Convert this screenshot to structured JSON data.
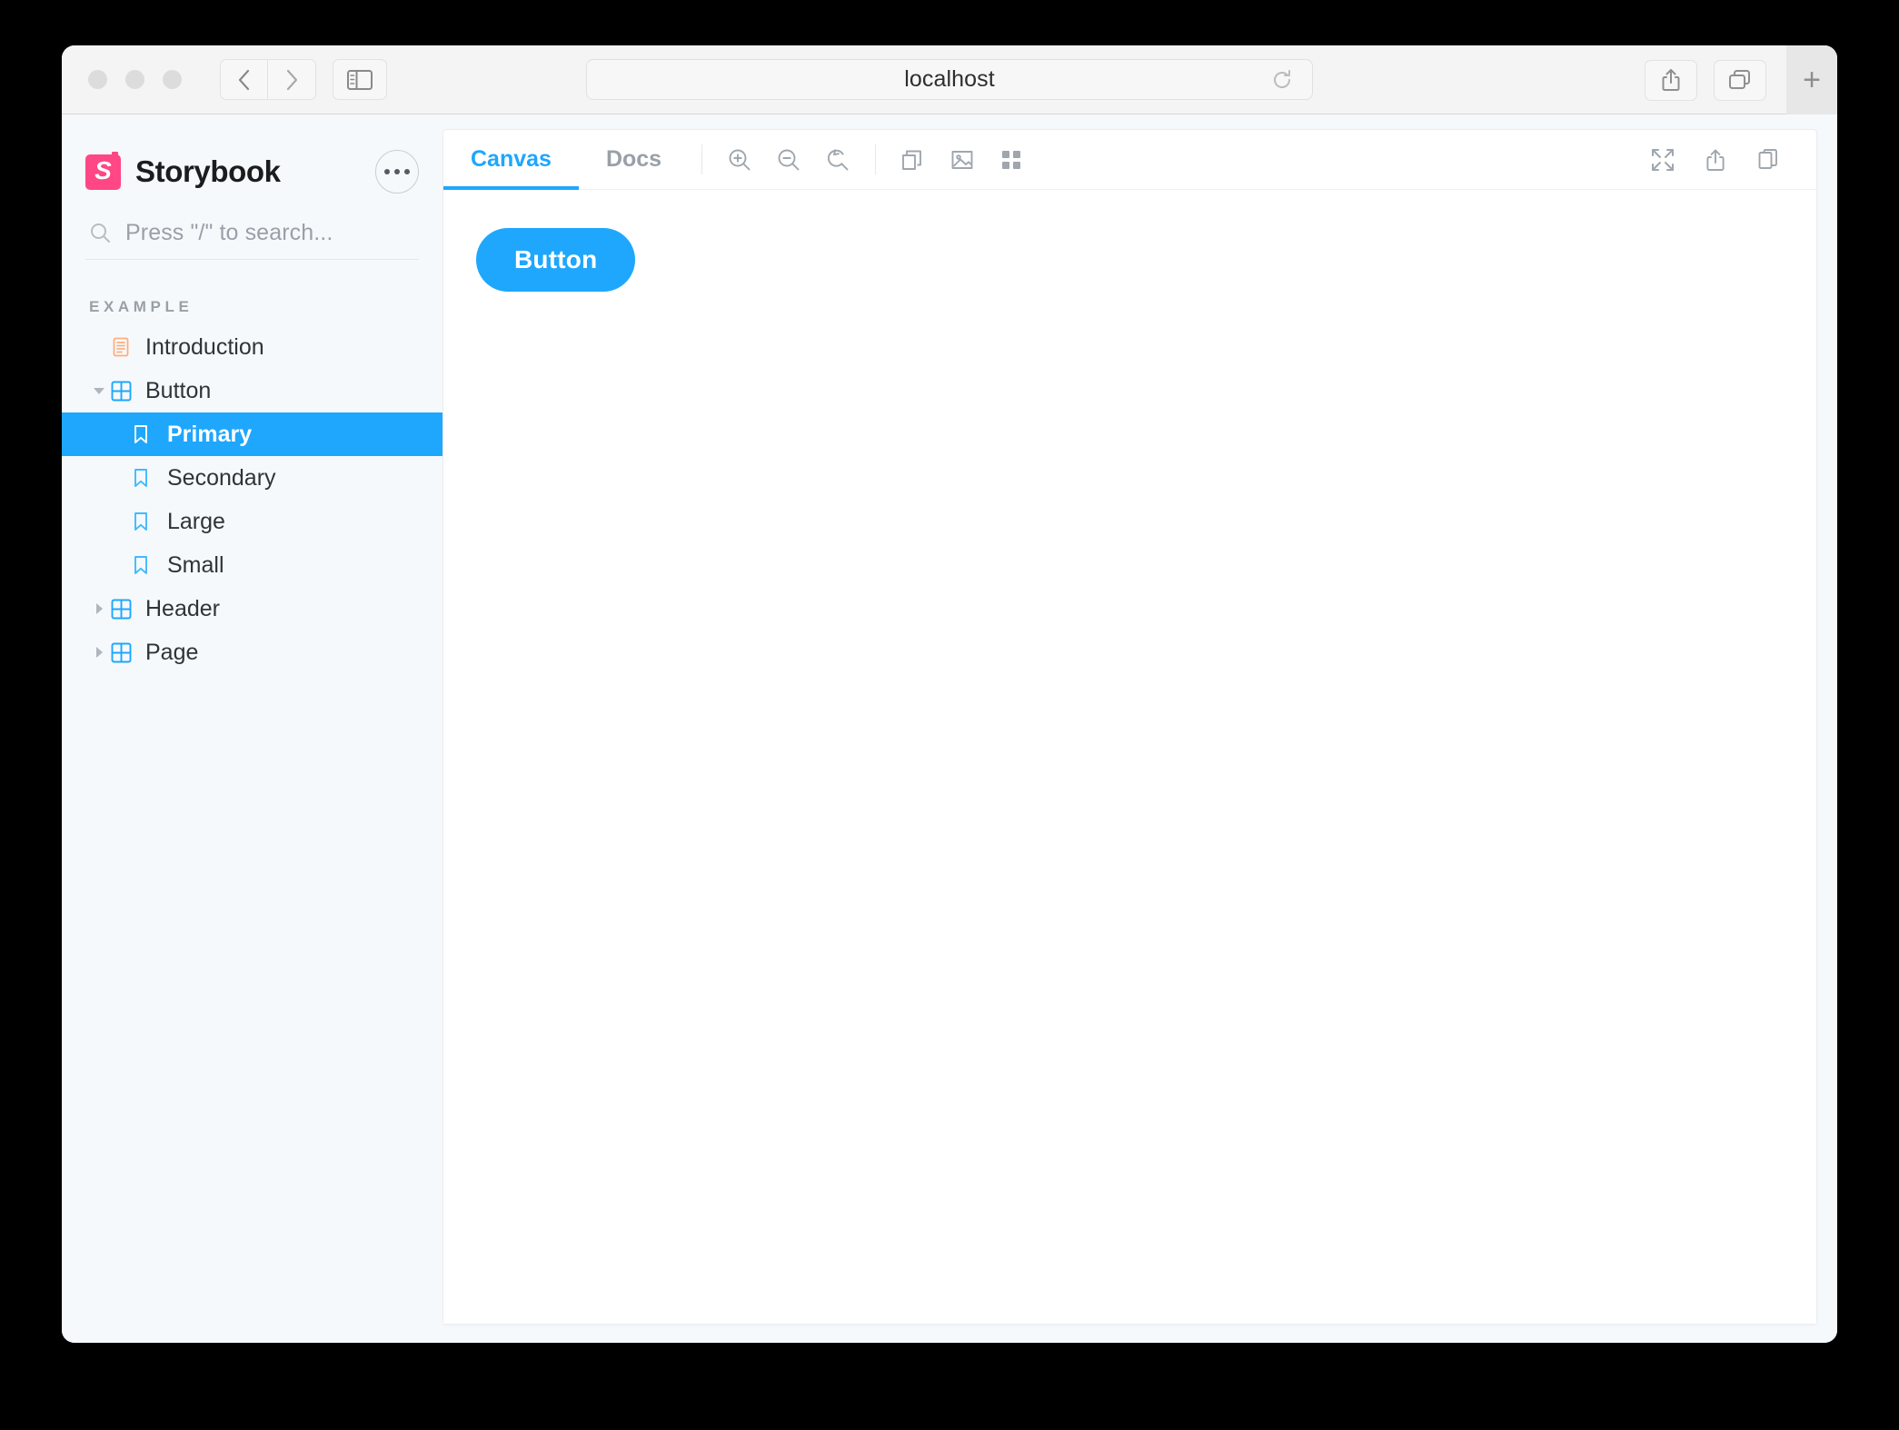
{
  "browser": {
    "address_value": "localhost",
    "traffic_lights": [
      "close",
      "minimize",
      "maximize"
    ],
    "back_label": "Back",
    "forward_label": "Forward",
    "sidebar_toggle_label": "Show sidebar",
    "reload_label": "Reload",
    "share_label": "Share",
    "tab_overview_label": "Tab Overview",
    "new_tab_label": "+"
  },
  "storybook": {
    "brand": "Storybook",
    "logo_letter": "S",
    "menu_label": "•••",
    "search": {
      "placeholder": "Press \"/\" to search...",
      "value": ""
    },
    "section_label": "EXAMPLE",
    "tree": [
      {
        "label": "Introduction",
        "icon": "document-icon",
        "level": 1,
        "caret": "none",
        "selected": false
      },
      {
        "label": "Button",
        "icon": "component-icon",
        "level": 1,
        "caret": "expanded",
        "selected": false
      },
      {
        "label": "Primary",
        "icon": "story-icon",
        "level": 2,
        "caret": "none",
        "selected": true
      },
      {
        "label": "Secondary",
        "icon": "story-icon",
        "level": 2,
        "caret": "none",
        "selected": false
      },
      {
        "label": "Large",
        "icon": "story-icon",
        "level": 2,
        "caret": "none",
        "selected": false
      },
      {
        "label": "Small",
        "icon": "story-icon",
        "level": 2,
        "caret": "none",
        "selected": false
      },
      {
        "label": "Header",
        "icon": "component-icon",
        "level": 1,
        "caret": "collapsed",
        "selected": false
      },
      {
        "label": "Page",
        "icon": "component-icon",
        "level": 1,
        "caret": "collapsed",
        "selected": false
      }
    ]
  },
  "preview": {
    "tabs": [
      {
        "label": "Canvas",
        "active": true
      },
      {
        "label": "Docs",
        "active": false
      }
    ],
    "tools_left": [
      {
        "name": "zoom-in-icon",
        "label": "Zoom in"
      },
      {
        "name": "zoom-out-icon",
        "label": "Zoom out"
      },
      {
        "name": "zoom-reset-icon",
        "label": "Reset zoom"
      }
    ],
    "tools_mid": [
      {
        "name": "viewport-icon",
        "label": "Change the size of the preview"
      },
      {
        "name": "background-icon",
        "label": "Change the background of the preview"
      },
      {
        "name": "grid-icon",
        "label": "Apply outlines to the preview"
      }
    ],
    "tools_right": [
      {
        "name": "fullscreen-icon",
        "label": "Go full screen"
      },
      {
        "name": "share-icon",
        "label": "Open canvas in new tab"
      },
      {
        "name": "copy-icon",
        "label": "Copy canvas link"
      }
    ],
    "story": {
      "button_label": "Button"
    }
  },
  "colors": {
    "accent_blue": "#1EA7FD",
    "brand_pink": "#FF4785",
    "doc_icon_orange": "#FFAE7E",
    "sidebar_bg": "#F6F9FC",
    "canvas_bg": "#FFFFFF",
    "text_primary": "#2E3438",
    "text_muted": "#9AA0A8"
  }
}
